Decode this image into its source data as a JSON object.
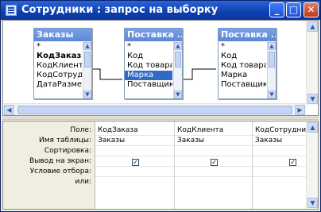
{
  "window": {
    "title": "Сотрудники : запрос на выборку",
    "minimize_glyph": "_",
    "maximize_glyph": "□",
    "close_glyph": "✕"
  },
  "tables": [
    {
      "name": "Заказы",
      "fields": [
        "*",
        "КодЗаказа",
        "КодКлиента",
        "КодСотрудни",
        "ДатаРазмещ"
      ],
      "bold_fields": [
        1
      ],
      "selected": -1
    },
    {
      "name": "Поставка ...",
      "fields": [
        "*",
        "Код",
        "Код товара",
        "Марка",
        "Поставщик"
      ],
      "bold_fields": [],
      "selected": 3
    },
    {
      "name": "Поставка ...",
      "fields": [
        "*",
        "Код",
        "Код товара",
        "Марка",
        "Поставщик"
      ],
      "bold_fields": [],
      "selected": -1
    }
  ],
  "grid": {
    "row_labels": [
      "Поле:",
      "Имя таблицы:",
      "Сортировка:",
      "Вывод на экран:",
      "Условие отбора:",
      "или:"
    ],
    "columns": [
      {
        "field": "КодЗаказа",
        "table": "Заказы",
        "sort": "",
        "show": true
      },
      {
        "field": "КодКлиента",
        "table": "Заказы",
        "sort": "",
        "show": true
      },
      {
        "field": "КодСотрудни",
        "table": "Заказы",
        "sort": "",
        "show": true
      }
    ]
  },
  "scroll_glyphs": {
    "up": "▲",
    "down": "▼",
    "left": "◀",
    "right": "▶"
  },
  "colors": {
    "title_bar": "#0d3fae",
    "table_header": "#5c86d6",
    "selection": "#316ac5"
  }
}
